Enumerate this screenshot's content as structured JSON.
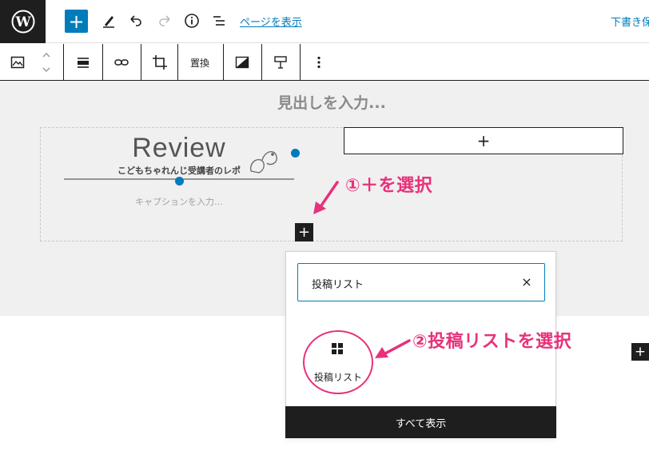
{
  "header": {
    "add_icon": "plus-icon",
    "preview_label": "ページを表示",
    "save_draft_label": "下書き保存"
  },
  "block_toolbar": {
    "replace_label": "置換"
  },
  "editor": {
    "heading_placeholder": "見出しを入力...",
    "image": {
      "logo_text": "Review",
      "logo_subtext": "こどもちゃれんじ受講者のレポ"
    },
    "caption_placeholder": "キャプションを入力…",
    "column_appender_label": "+",
    "inserter_toggle_label": "+"
  },
  "annotations": {
    "step1": "①＋を選択",
    "step2": "②投稿リストを選択",
    "color": "#e8317a"
  },
  "inserter": {
    "search_value": "投稿リスト",
    "clear_label": "×",
    "result": {
      "label": "投稿リスト",
      "icon": "grid-icon"
    },
    "show_all_label": "すべて表示"
  },
  "side_appender_label": "+",
  "colors": {
    "accent": "#007cba",
    "dark": "#1e1e1e",
    "canvas": "#f0f0f0"
  }
}
